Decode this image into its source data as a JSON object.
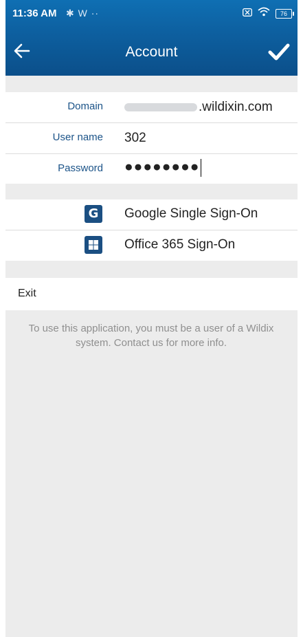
{
  "status_bar": {
    "time": "11:36 AM",
    "extra": "✱ W ··",
    "battery": "76"
  },
  "app_bar": {
    "title": "Account",
    "back_icon": "arrow-left-icon",
    "save_icon": "checkmark-icon"
  },
  "account": {
    "domain_label": "Domain",
    "domain_suffix": ".wildixin.com",
    "username_label": "User name",
    "username_value": "302",
    "password_label": "Password",
    "password_mask": "●●●●●●●●"
  },
  "sso": {
    "google_icon_letter": "G",
    "google_label": "Google Single Sign-On",
    "office_label": "Office 365 Sign-On"
  },
  "exit_label": "Exit",
  "info_text": "To use this application, you must be a user of a Wildix system. Contact us for more info.",
  "colors": {
    "app_bar": "#0d5f9f",
    "label_blue": "#1b5388",
    "icon_blue": "#1b4f82",
    "background": "#ececec"
  }
}
